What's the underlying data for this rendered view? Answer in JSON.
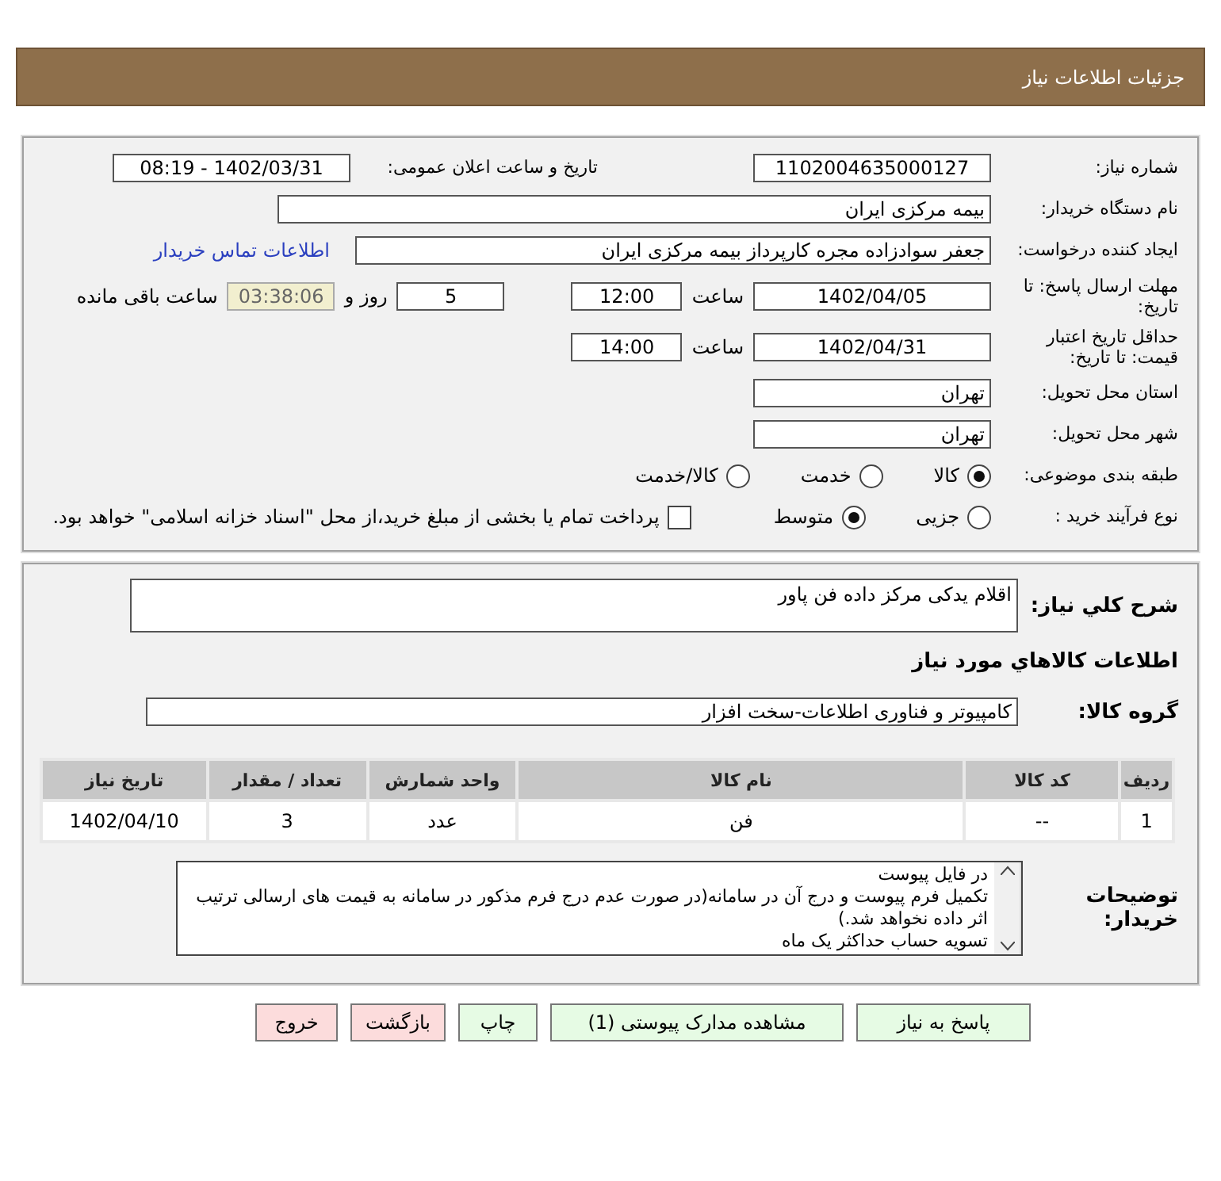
{
  "header": {
    "title": "جزئیات اطلاعات نیاز"
  },
  "need_number": {
    "label": "شماره نیاز:",
    "value": "1102004635000127"
  },
  "announce": {
    "label": "تاریخ و ساعت اعلان عمومی:",
    "value": "1402/03/31 - 08:19"
  },
  "buyer": {
    "label": "نام دستگاه خریدار:",
    "value": "بیمه مرکزی ایران"
  },
  "creator": {
    "label": "ایجاد کننده درخواست:",
    "value": "جعفر سوادزاده مجره کارپرداز بیمه مرکزی ایران",
    "link": "اطلاعات تماس خریدار"
  },
  "deadline": {
    "label": "مهلت ارسال پاسخ: تا تاریخ:",
    "date": "1402/04/05",
    "time_label": "ساعت",
    "time": "12:00",
    "days": "5",
    "days_label": "روز و",
    "remaining": "03:38:06",
    "remaining_label": "ساعت باقی مانده"
  },
  "validity": {
    "label": "حداقل تاریخ اعتبار قیمت: تا تاریخ:",
    "date": "1402/04/31",
    "time_label": "ساعت",
    "time": "14:00"
  },
  "province": {
    "label": "استان محل تحویل:",
    "value": "تهران"
  },
  "city": {
    "label": "شهر محل تحویل:",
    "value": "تهران"
  },
  "category": {
    "label": "طبقه بندی موضوعی:",
    "options": [
      {
        "label": "کالا",
        "selected": true
      },
      {
        "label": "خدمت",
        "selected": false
      },
      {
        "label": "کالا/خدمت",
        "selected": false
      }
    ]
  },
  "process": {
    "label": "نوع فرآیند خرید :",
    "options": [
      {
        "label": "جزیی",
        "selected": false
      },
      {
        "label": "متوسط",
        "selected": true
      }
    ],
    "treasury": {
      "label": "پرداخت تمام یا بخشی از مبلغ خرید،از محل \"اسناد خزانه اسلامی\" خواهد بود.",
      "checked": false
    }
  },
  "description": {
    "label": "شرح کلي نیاز:",
    "value": "اقلام یدکی مرکز داده فن پاور"
  },
  "goods_heading": "اطلاعات کالاهاي مورد نیاز",
  "goods_group": {
    "label": "گروه کالا:",
    "value": "کامپیوتر و فناوری اطلاعات-سخت افزار"
  },
  "table": {
    "columns": [
      "ردیف",
      "کد کالا",
      "نام کالا",
      "واحد شمارش",
      "تعداد / مقدار",
      "تاریخ نیاز"
    ],
    "rows": [
      [
        "1",
        "--",
        "فن",
        "عدد",
        "3",
        "1402/04/10"
      ]
    ]
  },
  "notes": {
    "label": "توضیحات خریدار:",
    "lines": [
      "در فایل پیوست",
      "تکمیل فرم پیوست و درج آن در سامانه(در صورت عدم درج فرم مذکور در سامانه به قیمت های ارسالی ترتیب اثر داده نخواهد شد.)",
      "تسویه حساب حداکثر یک ماه"
    ]
  },
  "buttons": [
    {
      "label": "پاسخ به نیاز",
      "kind": "green"
    },
    {
      "label": "مشاهده مدارک پیوستی (1)",
      "kind": "green"
    },
    {
      "label": "چاپ",
      "kind": "green"
    },
    {
      "label": "بازگشت",
      "kind": "red"
    },
    {
      "label": "خروج",
      "kind": "red"
    }
  ]
}
